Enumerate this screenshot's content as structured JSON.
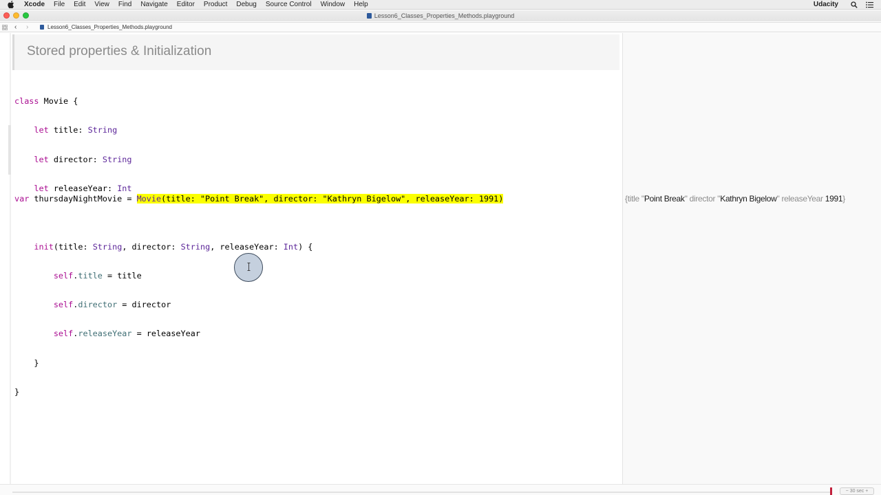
{
  "menubar": {
    "items": [
      "Xcode",
      "File",
      "Edit",
      "View",
      "Find",
      "Navigate",
      "Editor",
      "Product",
      "Debug",
      "Source Control",
      "Window",
      "Help"
    ],
    "right_label": "Udacity",
    "icons": [
      "apple-icon",
      "search-icon",
      "list-icon"
    ]
  },
  "window": {
    "title": "Lesson6_Classes_Properties_Methods.playground"
  },
  "jumpbar": {
    "file": "Lesson6_Classes_Properties_Methods.playground"
  },
  "markdown": {
    "heading": "Stored properties & Initialization"
  },
  "code": {
    "class_kw": "class",
    "class_name": "Movie",
    "let_kw": "let",
    "props": [
      {
        "name": "title",
        "type": "String"
      },
      {
        "name": "director",
        "type": "String"
      },
      {
        "name": "releaseYear",
        "type": "Int"
      }
    ],
    "init_kw": "init",
    "self_kw": "self",
    "var_kw": "var",
    "var_name": "thursdayNightMovie",
    "call_type": "Movie",
    "title_value": "\"Point Break\"",
    "director_value": "\"Kathryn Bigelow\"",
    "year_value": "1991"
  },
  "result": {
    "open": "{title \"",
    "title": "Point Break",
    "mid1": "\" director \"",
    "director": "Kathryn Bigelow",
    "mid2": "\" releaseYear ",
    "year": "1991",
    "close": "}"
  },
  "timeline": {
    "duration_label": "30 sec"
  },
  "colors": {
    "keyword": "#aa0d91",
    "type": "#5c2699",
    "property": "#3f6e74",
    "string": "#c41a16",
    "number": "#1c00cf",
    "highlight": "#fbff00"
  }
}
